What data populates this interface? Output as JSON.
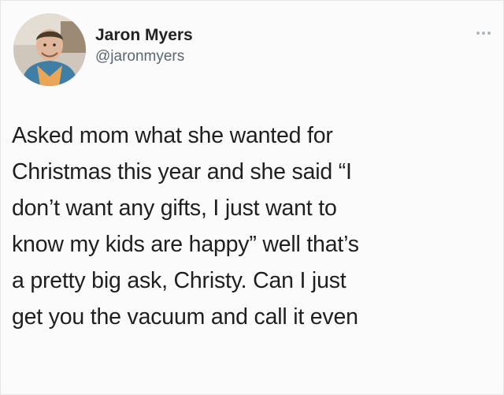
{
  "tweet": {
    "author": {
      "display_name": "Jaron Myers",
      "handle": "@jaronmyers",
      "avatar_icon": "profile-photo"
    },
    "more_icon": "more-options-icon",
    "text_lines": [
      "Asked mom what she wanted for",
      "Christmas this year and she said “I",
      "don’t want any gifts, I just want to",
      "know my kids are happy” well that’s",
      "a pretty big ask, Christy. Can I just",
      "get you the vacuum and call it even"
    ]
  },
  "colors": {
    "background": "#fbfbfb",
    "name": "#222222",
    "handle": "#5b6670",
    "text": "#1f1f1f"
  }
}
